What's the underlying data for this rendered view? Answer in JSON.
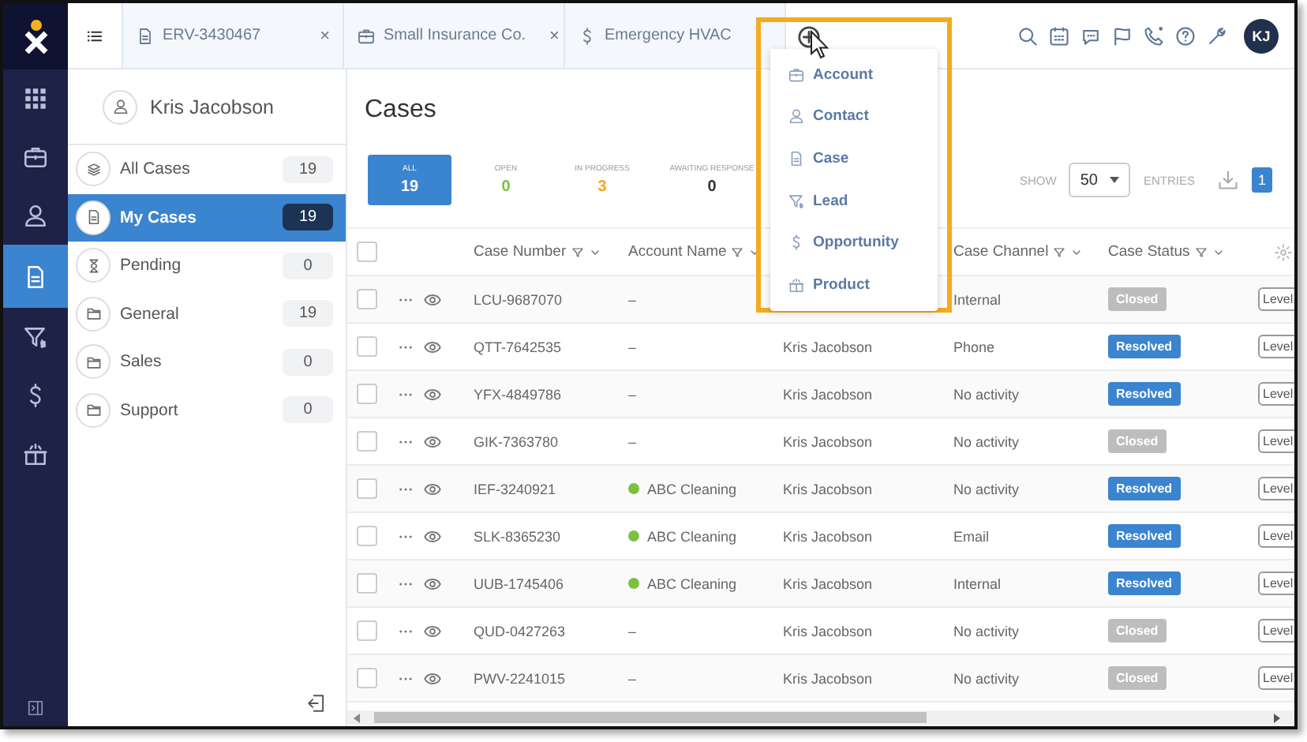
{
  "nav_rail": {
    "items": [
      {
        "selected": false
      },
      {
        "selected": false
      },
      {
        "selected": false
      },
      {
        "selected": true
      },
      {
        "selected": false
      },
      {
        "selected": false
      },
      {
        "selected": false
      }
    ]
  },
  "tabs": [
    {
      "selected": true
    },
    {
      "label": "ERV-3430467",
      "close": "×",
      "selected": false
    },
    {
      "label": "Small Insurance Co.",
      "close": "×",
      "selected": false
    },
    {
      "label": "Emergency HVAC",
      "selected": false
    }
  ],
  "avatar": {
    "initials": "KJ"
  },
  "sidebar": {
    "user": "Kris Jacobson",
    "items": [
      {
        "label": "All Cases",
        "count": "19",
        "selected": false
      },
      {
        "label": "My Cases",
        "count": "19",
        "selected": true
      },
      {
        "label": "Pending",
        "count": "0",
        "selected": false
      },
      {
        "label": "General",
        "count": "19",
        "selected": false
      },
      {
        "label": "Sales",
        "count": "0",
        "selected": false
      },
      {
        "label": "Support",
        "count": "0",
        "selected": false
      }
    ]
  },
  "page_title": "Cases",
  "stats": [
    {
      "label": "ALL",
      "value": "19",
      "color": "#ffffff",
      "selected": true
    },
    {
      "label": "OPEN",
      "value": "0",
      "color": "#7ac143",
      "selected": false
    },
    {
      "label": "IN PROGRESS",
      "value": "3",
      "color": "#f5a623",
      "selected": false
    },
    {
      "label": "AWAITING RESPONSE",
      "value": "0",
      "color": "#333333",
      "selected": false
    }
  ],
  "paging": {
    "show": "SHOW",
    "page_size": "50",
    "entries": "ENTRIES",
    "page": "1"
  },
  "add_menu": {
    "items": [
      {
        "label": "Account"
      },
      {
        "label": "Contact"
      },
      {
        "label": "Case"
      },
      {
        "label": "Lead"
      },
      {
        "label": "Opportunity"
      },
      {
        "label": "Product"
      }
    ]
  },
  "table": {
    "all_checked": false,
    "columns": [
      "Case Number",
      "Account Name",
      "",
      "Case Channel",
      "Case Status"
    ],
    "rows": [
      {
        "checked": false,
        "number": "LCU-9687070",
        "account": "–",
        "channel": "Internal",
        "status": "Closed",
        "kind": "closed",
        "level": "Level"
      },
      {
        "checked": false,
        "number": "QTT-7642535",
        "account": "–",
        "owner": "Kris Jacobson",
        "channel": "Phone",
        "status": "Resolved",
        "kind": "resolved",
        "level": "Level"
      },
      {
        "checked": false,
        "number": "YFX-4849786",
        "account": "–",
        "owner": "Kris Jacobson",
        "channel": "No activity",
        "status": "Resolved",
        "kind": "resolved",
        "level": "Level"
      },
      {
        "checked": false,
        "number": "GIK-7363780",
        "account": "–",
        "owner": "Kris Jacobson",
        "channel": "No activity",
        "status": "Closed",
        "kind": "closed",
        "level": "Level"
      },
      {
        "checked": false,
        "number": "IEF-3240921",
        "account": "ABC Cleaning",
        "color": "#7ac143",
        "owner": "Kris Jacobson",
        "channel": "No activity",
        "status": "Resolved",
        "kind": "resolved",
        "level": "Level"
      },
      {
        "checked": false,
        "number": "SLK-8365230",
        "account": "ABC Cleaning",
        "color": "#7ac143",
        "owner": "Kris Jacobson",
        "channel": "Email",
        "status": "Resolved",
        "kind": "resolved",
        "level": "Level"
      },
      {
        "checked": false,
        "number": "UUB-1745406",
        "account": "ABC Cleaning",
        "color": "#7ac143",
        "owner": "Kris Jacobson",
        "channel": "Internal",
        "status": "Resolved",
        "kind": "resolved",
        "level": "Level"
      },
      {
        "checked": false,
        "number": "QUD-0427263",
        "account": "–",
        "owner": "Kris Jacobson",
        "channel": "No activity",
        "status": "Closed",
        "kind": "closed",
        "level": "Level"
      },
      {
        "checked": false,
        "number": "PWV-2241015",
        "account": "–",
        "owner": "Kris Jacobson",
        "channel": "No activity",
        "status": "Closed",
        "kind": "closed",
        "level": "Level"
      }
    ]
  }
}
